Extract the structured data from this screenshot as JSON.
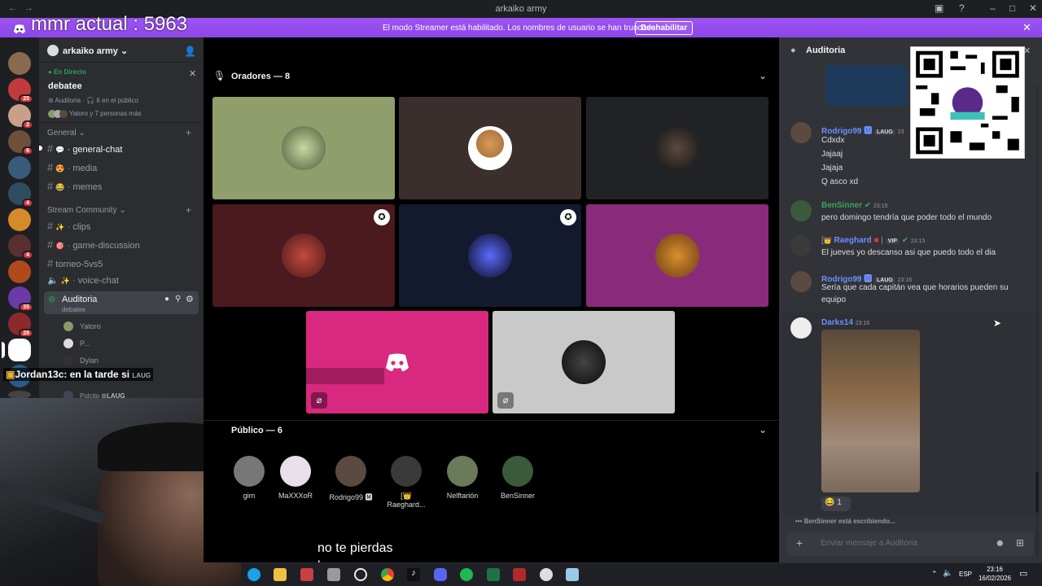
{
  "window": {
    "title": "arkaiko army",
    "back": "←",
    "forward": "→",
    "controls": [
      "▣",
      "?",
      "–",
      "□",
      "✕"
    ]
  },
  "streamer_bar": {
    "message": "El modo Streamer está habilitado. Los nombres de usuario se han truncado.",
    "button": "Deshabilitar",
    "close": "✕"
  },
  "overlay": {
    "mmr": "mmr actual : 5963",
    "chat_user": "Jordan13c",
    "chat_text": ": en la tarde si",
    "chat_tag": "LAUG",
    "caption_line1": "no te pierdas",
    "caption_line2": "las sorpresas"
  },
  "guilds": {
    "badges": [
      "25",
      "2",
      "6",
      "4",
      "4",
      "35",
      "28"
    ],
    "colors": [
      "#8a6a4f",
      "#c23b3b",
      "#c8a08a",
      "#6e4f3a",
      "#3a5a7a",
      "#2f4d5e",
      "#d68a2a",
      "#5a2f2f",
      "#b04a1a",
      "#6a3aa8",
      "#8a2a2a",
      "#2a5a8a",
      "#444"
    ]
  },
  "server": {
    "name": "arkaiko army",
    "live_label": "En Directo",
    "live_channel": "debatee",
    "live_sub": "Auditoria",
    "live_audience": "6 en el público",
    "live_people": "Yatoro y 7 personas más",
    "category1": "General",
    "channels1": [
      {
        "name": "general-chat",
        "emoji": "💬"
      },
      {
        "name": "media",
        "emoji": "😍"
      },
      {
        "name": "memes",
        "emoji": "😂"
      }
    ],
    "category2": "Stream Community",
    "channels2": [
      {
        "name": "clips",
        "emoji": "✨"
      },
      {
        "name": "game-discussion",
        "emoji": "🎯"
      },
      {
        "name": "torneo-5vs5",
        "emoji": ""
      },
      {
        "name": "voice-chat",
        "emoji": "✨"
      }
    ],
    "stage_channel": "Auditoria",
    "stage_sub": "debatee",
    "members": [
      "Yatoro",
      "P...",
      "Dylan",
      "Polcito"
    ],
    "member_tag": "LAUG"
  },
  "stage": {
    "speakers_title": "Oradores — 8",
    "audience_title": "Público — 6",
    "audience": [
      "gim",
      "MaXXXoR",
      "Rodrigo99 🅼",
      "[👑Raeghard...",
      "Nelftarión",
      "BenSinner"
    ],
    "speaker_tiles": [
      "#8f9e6a",
      "#3b2f2d",
      "#202225",
      "#4a1a1e",
      "#141a2e",
      "#8a2a7a"
    ],
    "bottom_tiles": [
      "#d8287f",
      "#c9c9c9"
    ]
  },
  "chat": {
    "header": "Auditoria",
    "messages": [
      {
        "name": "Rodrigo99 🅼",
        "tag": "LAUG",
        "time": "23",
        "color": "#6b90ff",
        "lines": [
          "Cdxdx",
          "Jajaaj",
          "Jajaja",
          "Q asco xd"
        ]
      },
      {
        "name": "BenSinner",
        "tag": "",
        "time": "23:15",
        "color": "#3ba55d",
        "lines": [
          "pero domingo tendría que poder todo el mundo"
        ]
      },
      {
        "name": "Raeghard",
        "tag": "VIP",
        "time": "23:15",
        "color": "#6b90ff",
        "lines": [
          "El jueves yo descanso asi que puedo todo el dia"
        ]
      },
      {
        "name": "Rodrigo99 🅼",
        "tag": "LAUG",
        "time": "23:16",
        "color": "#6b90ff",
        "lines": [
          "Sería que cada capitán vea que horarios pueden su",
          "equipo"
        ]
      },
      {
        "name": "Darks14",
        "tag": "",
        "time": "23:16",
        "color": "#6b90ff",
        "lines": []
      }
    ],
    "reaction_count": "1",
    "typing": "BenSinner está escribiendo...",
    "input_placeholder": "Enviar mensaje a Auditoria"
  },
  "taskbar": {
    "icons": [
      "edge-icon",
      "folder-icon",
      "app-icon",
      "app2-icon",
      "obs-icon",
      "chrome-icon",
      "tiktok-icon",
      "discord-icon",
      "spotify-icon",
      "excel-icon",
      "app3-icon",
      "app4-icon",
      "app5-icon"
    ],
    "lang": "ESP",
    "time": "23:16",
    "date": "16/02/2026"
  }
}
